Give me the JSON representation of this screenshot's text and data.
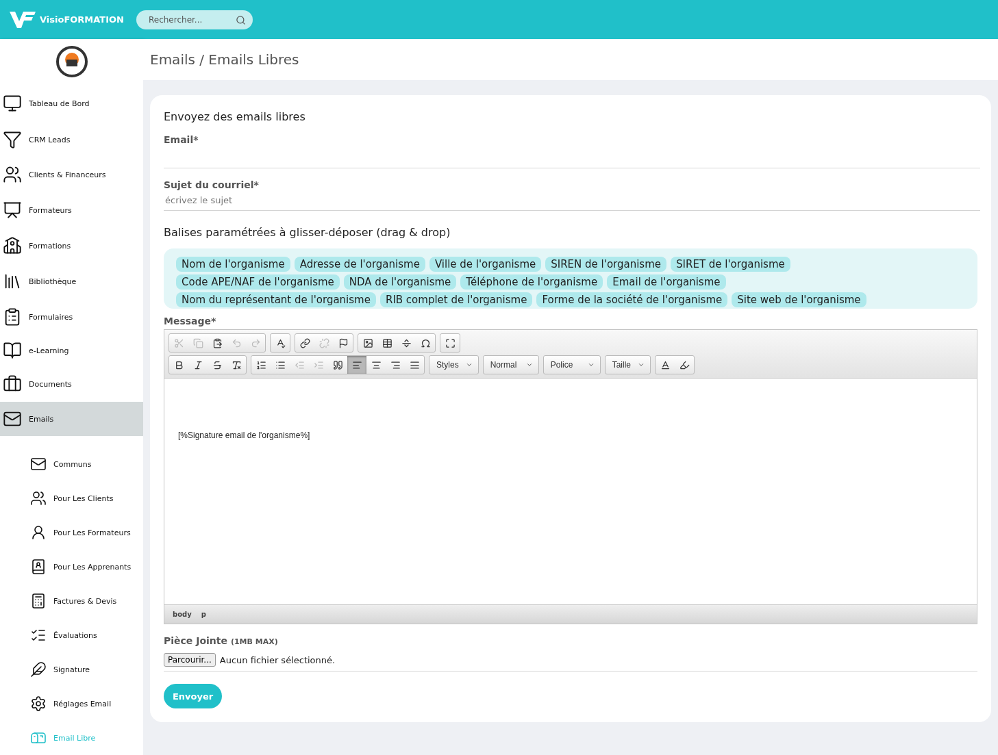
{
  "header": {
    "brand": "VisioFORMATION",
    "search": {
      "placeholder": "Rechercher..."
    }
  },
  "sidebar": {
    "items": [
      {
        "kind": "monitor",
        "label": "Tableau de Bord",
        "selected": false
      },
      {
        "kind": "funnel",
        "label": "CRM Leads",
        "selected": false
      },
      {
        "kind": "users",
        "label": "Clients & Financeurs",
        "selected": false
      },
      {
        "kind": "presentation",
        "label": "Formateurs",
        "selected": false
      },
      {
        "kind": "school",
        "label": "Formations",
        "selected": false
      },
      {
        "kind": "library",
        "label": "Bibliothèque",
        "selected": false
      },
      {
        "kind": "clipboard",
        "label": "Formulaires",
        "selected": false
      },
      {
        "kind": "book",
        "label": "e-Learning",
        "selected": false
      },
      {
        "kind": "briefcase",
        "label": "Documents",
        "selected": false
      },
      {
        "kind": "mail",
        "label": "Emails",
        "selected": true,
        "children": [
          {
            "kind": "mail-circle",
            "label": "Communs",
            "selected": false
          },
          {
            "kind": "users",
            "label": "Pour Les Clients",
            "selected": false
          },
          {
            "kind": "user",
            "label": "Pour Les Formateurs",
            "selected": false
          },
          {
            "kind": "reader",
            "label": "Pour Les Apprenants",
            "selected": false
          },
          {
            "kind": "calculator",
            "label": "Factures & Devis",
            "selected": false
          },
          {
            "kind": "checklist",
            "label": "Évaluations",
            "selected": false
          },
          {
            "kind": "feather",
            "label": "Signature",
            "selected": false
          },
          {
            "kind": "settings",
            "label": "Réglages Email",
            "selected": false
          },
          {
            "kind": "mailbox",
            "label": "Email Libre",
            "selected": true
          }
        ]
      }
    ]
  },
  "breadcrumb": "Emails / Emails Libres",
  "form": {
    "title": "Envoyez des emails libres",
    "email": {
      "label": "Email*"
    },
    "subject": {
      "label": "Sujet du courriel*",
      "placeholder": "écrivez le sujet"
    },
    "tags_title": "Balises paramétrées à glisser-déposer (drag & drop)",
    "tags": [
      [
        "Nom de l'organisme",
        "Adresse de l'organisme",
        "Ville de l'organisme",
        "SIREN de l'organisme",
        "SIRET de l'organisme"
      ],
      [
        "Code APE/NAF de l'organisme",
        "NDA de l'organisme",
        "Téléphone de l'organisme",
        "Email de l'organisme"
      ],
      [
        "Nom du représentant de l'organisme",
        "RIB complet de l'organisme",
        "Forme de la société de l'organisme",
        "Site web de l'organisme"
      ]
    ],
    "message_label": "Message*",
    "toolbar": [
      [
        [
          {
            "kind": "cut",
            "disabled": true
          },
          {
            "kind": "copy",
            "disabled": true
          },
          {
            "kind": "paste",
            "disabled": false
          },
          {
            "kind": "undo",
            "disabled": true
          },
          {
            "kind": "redo",
            "disabled": true
          }
        ],
        [
          {
            "kind": "spellcheck",
            "disabled": false
          }
        ],
        [
          {
            "kind": "link",
            "disabled": false
          },
          {
            "kind": "unlink",
            "disabled": true
          },
          {
            "kind": "anchor",
            "disabled": false
          }
        ],
        [
          {
            "kind": "image",
            "disabled": false
          },
          {
            "kind": "table",
            "disabled": false
          },
          {
            "kind": "rule",
            "disabled": false
          },
          {
            "kind": "omega",
            "disabled": false
          }
        ],
        [
          {
            "kind": "maximize",
            "disabled": false
          }
        ]
      ],
      [
        [
          {
            "kind": "bold",
            "disabled": false
          },
          {
            "kind": "italic",
            "disabled": false
          },
          {
            "kind": "strike",
            "disabled": false
          },
          {
            "kind": "clear",
            "disabled": false
          }
        ],
        [
          {
            "kind": "ol",
            "disabled": false
          },
          {
            "kind": "ul",
            "disabled": false
          },
          {
            "kind": "outdent",
            "disabled": true
          },
          {
            "kind": "indent",
            "disabled": true
          },
          {
            "kind": "quote",
            "disabled": false
          },
          {
            "kind": "align-left",
            "selected": true
          },
          {
            "kind": "align-center",
            "selected": false
          },
          {
            "kind": "align-right",
            "selected": false
          },
          {
            "kind": "align-justify",
            "selected": false
          }
        ],
        [
          {
            "kind": "select",
            "label": "Styles"
          }
        ],
        [
          {
            "kind": "select",
            "label": "Normal"
          }
        ],
        [
          {
            "kind": "select",
            "label": "Police"
          }
        ],
        [
          {
            "kind": "select",
            "label": "Taille"
          }
        ],
        [
          {
            "kind": "text-color"
          },
          {
            "kind": "bg-color"
          }
        ]
      ]
    ],
    "body": "[%Signature email de l'organisme%]",
    "path": [
      "body",
      "p"
    ],
    "attachment": {
      "label": "Pièce Jointe",
      "note": "(1MB MAX)",
      "button": "Parcourir...",
      "status": "Aucun fichier sélectionné."
    },
    "submit": "Envoyer"
  }
}
